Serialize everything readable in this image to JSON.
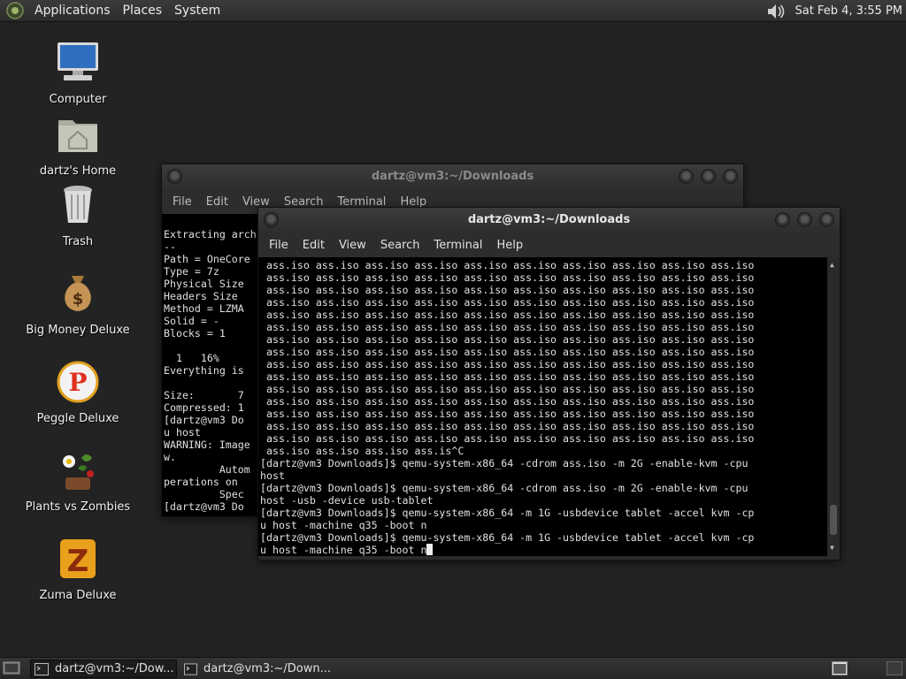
{
  "top_panel": {
    "menus": [
      "Applications",
      "Places",
      "System"
    ],
    "clock": "Sat Feb  4,  3:55 PM",
    "icons": [
      "gnome-foot-icon",
      "volume-icon"
    ]
  },
  "desktop": {
    "icons": [
      {
        "label": "Computer",
        "icon": "computer-icon"
      },
      {
        "label": "dartz's Home",
        "icon": "home-folder-icon"
      },
      {
        "label": "Trash",
        "icon": "trash-icon"
      },
      {
        "label": "Big Money Deluxe",
        "icon": "money-bag-icon"
      },
      {
        "label": "Peggle Deluxe",
        "icon": "peggle-icon"
      },
      {
        "label": "Plants vs Zombies",
        "icon": "flower-icon"
      },
      {
        "label": "Zuma Deluxe",
        "icon": "zuma-icon"
      }
    ]
  },
  "back_window": {
    "title": "dartz@vm3:~/Downloads",
    "menus": [
      "File",
      "Edit",
      "View",
      "Search",
      "Terminal",
      "Help"
    ],
    "lines": [
      "",
      "Extracting archive",
      "--",
      "Path = OneCore",
      "Type = 7z",
      "Physical Size",
      "Headers Size",
      "Method = LZMA",
      "Solid = -",
      "Blocks = 1",
      "",
      "  1   16%",
      "Everything is",
      "",
      "Size:       7",
      "Compressed: 1",
      "[dartz@vm3 Do",
      "u host",
      "WARNING: Image",
      "w.",
      "         Autom",
      "perations on",
      "         Spec",
      "[dartz@vm3 Do"
    ]
  },
  "front_window": {
    "title": "dartz@vm3:~/Downloads",
    "menus": [
      "File",
      "Edit",
      "View",
      "Search",
      "Terminal",
      "Help"
    ],
    "iso_line": " ass.iso ass.iso ass.iso ass.iso ass.iso ass.iso ass.iso ass.iso ass.iso ass.iso",
    "iso_line_count": 15,
    "iso_last": " ass.iso ass.iso ass.iso ass.is^C",
    "commands": [
      "[dartz@vm3 Downloads]$ qemu-system-x86_64 -cdrom ass.iso -m 2G -enable-kvm -cpu",
      "host",
      "[dartz@vm3 Downloads]$ qemu-system-x86_64 -cdrom ass.iso -m 2G -enable-kvm -cpu",
      "host -usb -device usb-tablet",
      "[dartz@vm3 Downloads]$ qemu-system-x86_64 -m 1G -usbdevice tablet -accel kvm -cp",
      "u host -machine q35 -boot n",
      "[dartz@vm3 Downloads]$ qemu-system-x86_64 -m 1G -usbdevice tablet -accel kvm -cp"
    ],
    "prompt_line": "u host -machine q35 -boot n"
  },
  "taskbar": {
    "tasks": [
      "dartz@vm3:~/Dow...",
      "dartz@vm3:~/Down..."
    ]
  },
  "colors": {
    "desktop_bg": "#232323",
    "terminal_bg": "#000000",
    "terminal_fg": "#e0e0e0"
  }
}
